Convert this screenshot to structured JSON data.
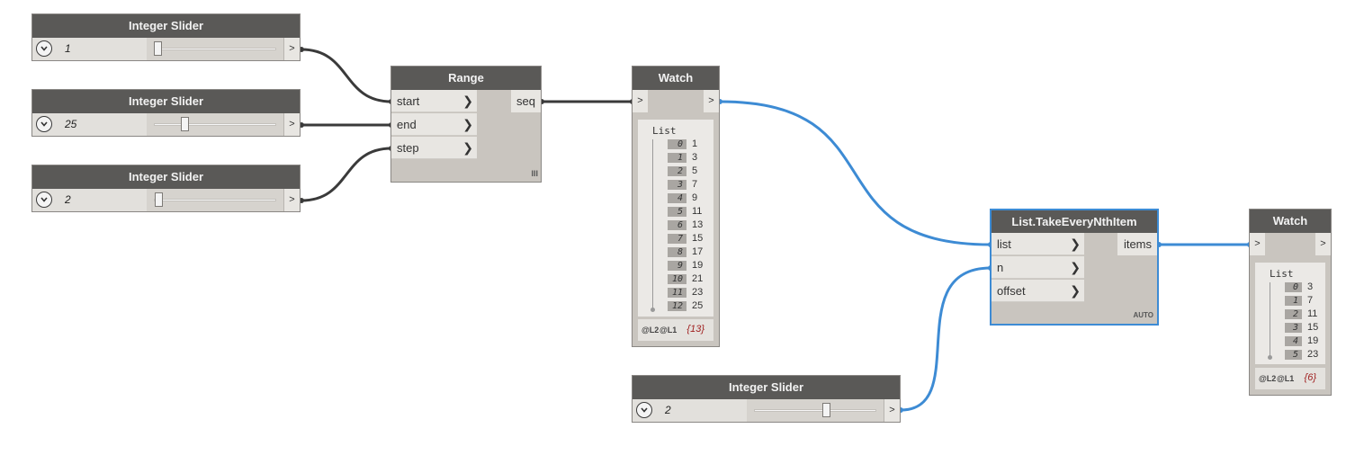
{
  "wire_colors": {
    "dark": "#3a3a3a",
    "selected": "#3d8bd4"
  },
  "sliders": [
    {
      "title": "Integer Slider",
      "value": "1",
      "output": ">",
      "level": 0.0
    },
    {
      "title": "Integer Slider",
      "value": "25",
      "output": ">",
      "level": 0.24
    },
    {
      "title": "Integer Slider",
      "value": "2",
      "output": ">",
      "level": 0.01
    },
    {
      "title": "Integer Slider",
      "value": "2",
      "output": ">",
      "level": 0.6
    }
  ],
  "range": {
    "title": "Range",
    "inputs": [
      "start",
      "end",
      "step"
    ],
    "output": "seq",
    "lacing": "III"
  },
  "watch1": {
    "title": "Watch",
    "in": ">",
    "out": ">",
    "list_label": "List",
    "items": [
      {
        "i": "0",
        "v": "1"
      },
      {
        "i": "1",
        "v": "3"
      },
      {
        "i": "2",
        "v": "5"
      },
      {
        "i": "3",
        "v": "7"
      },
      {
        "i": "4",
        "v": "9"
      },
      {
        "i": "5",
        "v": "11"
      },
      {
        "i": "6",
        "v": "13"
      },
      {
        "i": "7",
        "v": "15"
      },
      {
        "i": "8",
        "v": "17"
      },
      {
        "i": "9",
        "v": "19"
      },
      {
        "i": "10",
        "v": "21"
      },
      {
        "i": "11",
        "v": "23"
      },
      {
        "i": "12",
        "v": "25"
      }
    ],
    "levels": [
      "@L2",
      "@L1"
    ],
    "count": "{13}"
  },
  "take": {
    "title": "List.TakeEveryNthItem",
    "inputs": [
      "list",
      "n",
      "offset"
    ],
    "output": "items",
    "lacing": "AUTO"
  },
  "watch2": {
    "title": "Watch",
    "in": ">",
    "out": ">",
    "list_label": "List",
    "items": [
      {
        "i": "0",
        "v": "3"
      },
      {
        "i": "1",
        "v": "7"
      },
      {
        "i": "2",
        "v": "11"
      },
      {
        "i": "3",
        "v": "15"
      },
      {
        "i": "4",
        "v": "19"
      },
      {
        "i": "5",
        "v": "23"
      }
    ],
    "levels": [
      "@L2",
      "@L1"
    ],
    "count": "{6}"
  }
}
